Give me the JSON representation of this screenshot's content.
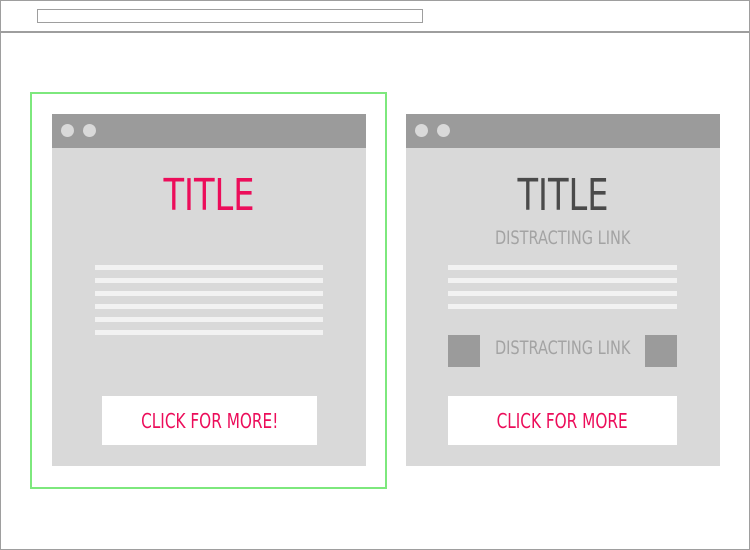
{
  "left": {
    "title": "TITLE",
    "cta_label": "CLICK FOR MORE!",
    "text_line_count": 6
  },
  "right": {
    "title": "TITLE",
    "distracting_link_top": "DISTRACTING LINK",
    "distracting_link_middle": "DISTRACTING LINK",
    "cta_label": "CLICK FOR MORE",
    "text_line_count": 4
  },
  "colors": {
    "accent": "#ec0d5a",
    "highlight": "#7de87d",
    "dark_title": "#4a4a4a",
    "muted": "#a3a3a3",
    "panel": "#d9d9d9",
    "bar": "#9b9b9b"
  }
}
